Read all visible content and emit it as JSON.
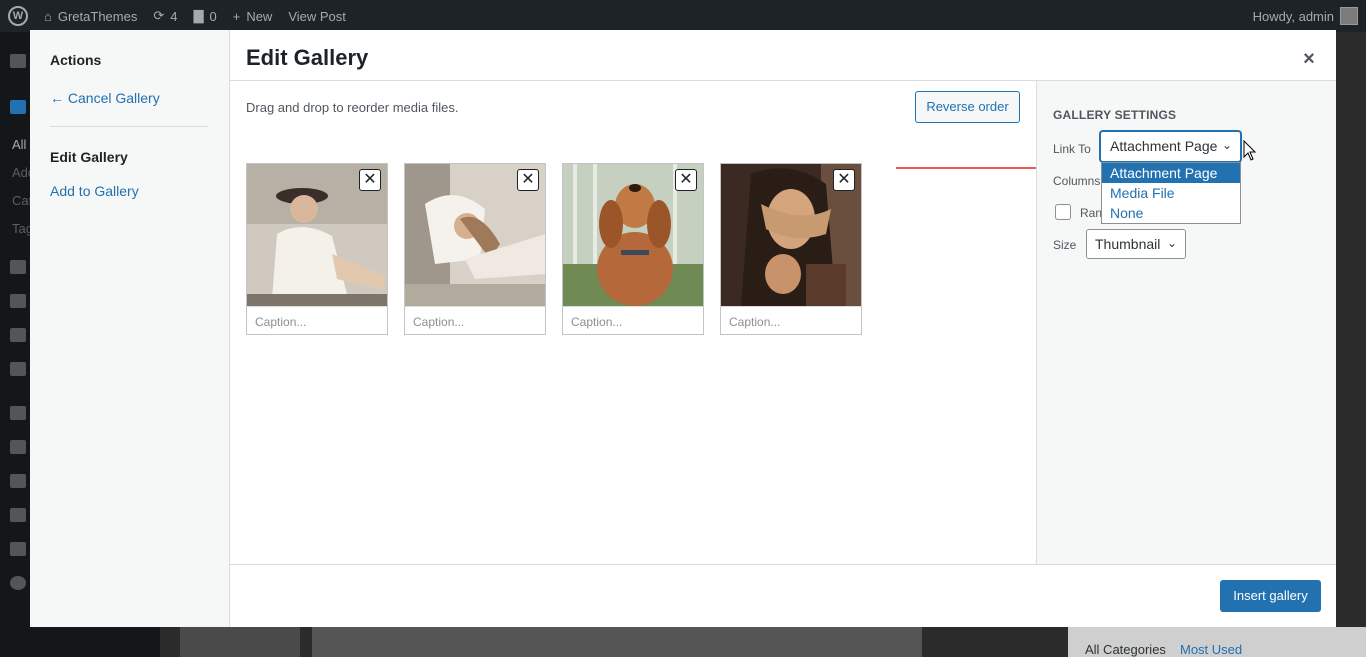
{
  "adminbar": {
    "site_name": "GretaThemes",
    "updates_count": "4",
    "comments_count": "0",
    "new_label": "New",
    "view_post_label": "View Post",
    "greeting": "Howdy, admin"
  },
  "admin_menu": {
    "visible_fragments": [
      "All",
      "Add",
      "Cat",
      "Tag"
    ]
  },
  "bg": {
    "category_tabs": [
      "All Categories",
      "Most Used"
    ]
  },
  "menu": {
    "heading": "Actions",
    "cancel_label": "← Cancel Gallery",
    "active_label": "Edit Gallery",
    "add_label": "Add to Gallery"
  },
  "modal": {
    "title": "Edit Gallery",
    "close_glyph": "×",
    "instructions": "Drag and drop to reorder media files.",
    "reverse_label": "Reverse order",
    "insert_label": "Insert gallery"
  },
  "attachments": [
    {
      "caption_placeholder": "Caption...",
      "icon": "woman-in-hat-photo",
      "colors": [
        "#d9d4cc",
        "#f1ede6",
        "#5b4a3f"
      ]
    },
    {
      "caption_placeholder": "Caption...",
      "icon": "woman-on-sofa-photo",
      "colors": [
        "#cfc8bd",
        "#f4f1ec",
        "#8a6f58"
      ]
    },
    {
      "caption_placeholder": "Caption...",
      "icon": "dog-photo",
      "colors": [
        "#b9c7b4",
        "#c27a44",
        "#6e7f55"
      ]
    },
    {
      "caption_placeholder": "Caption...",
      "icon": "woman-hair-photo",
      "colors": [
        "#5a4033",
        "#c79a6f",
        "#2e2119"
      ]
    }
  ],
  "remove_glyph": "✕",
  "settings": {
    "title": "GALLERY SETTINGS",
    "link_to_label": "Link To",
    "link_to_value": "Attachment Page",
    "link_options": [
      "Attachment Page",
      "Media File",
      "None"
    ],
    "columns_label": "Columns",
    "random_label_visible": "Ran",
    "size_label": "Size",
    "size_value": "Thumbnail",
    "chevron_glyph": "⌄"
  },
  "colors": {
    "accent": "#2271b1",
    "arrow": "#e02424"
  }
}
